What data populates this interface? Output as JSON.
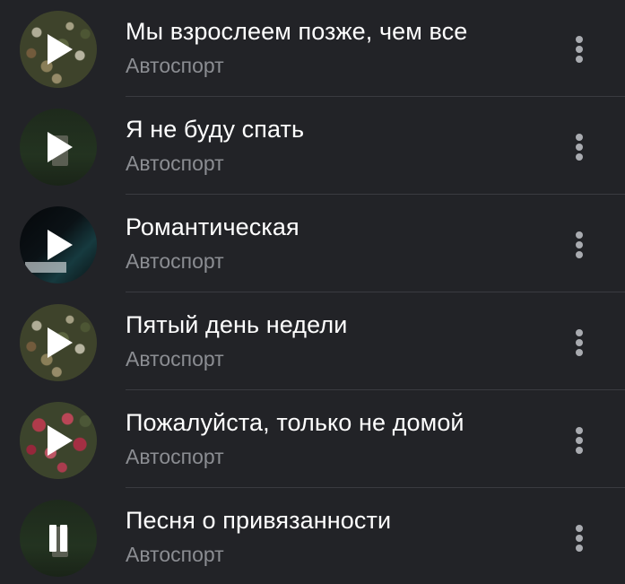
{
  "tracks": [
    {
      "title": "Мы взрослеем позже, чем все",
      "artist": "Автоспорт",
      "state": "play",
      "cover_icon": "play-icon"
    },
    {
      "title": "Я не буду спать",
      "artist": "Автоспорт",
      "state": "play",
      "cover_icon": "play-icon"
    },
    {
      "title": "Романтическая",
      "artist": "Автоспорт",
      "state": "play",
      "cover_icon": "play-icon"
    },
    {
      "title": "Пятый день недели",
      "artist": "Автоспорт",
      "state": "play",
      "cover_icon": "play-icon"
    },
    {
      "title": "Пожалуйста, только не домой",
      "artist": "Автоспорт",
      "state": "play",
      "cover_icon": "play-icon"
    },
    {
      "title": "Песня о привязанности",
      "artist": "Автоспорт",
      "state": "playing",
      "cover_icon": "pause-icon"
    }
  ],
  "colors": {
    "background": "#222327",
    "title": "#ffffff",
    "artist": "#8b8d92",
    "divider": "#3a3b40",
    "more_icon": "#a9abb0"
  }
}
